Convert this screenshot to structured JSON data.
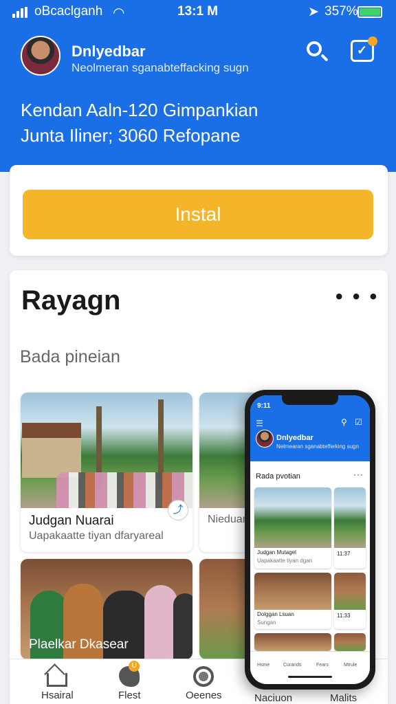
{
  "status_bar": {
    "carrier": "oBcaclganh",
    "time": "13:1 M",
    "battery_pct": "357%",
    "battery_color": "#3fd36a"
  },
  "header": {
    "background": "#1a6fe6",
    "user_name": "Dnlyedbar",
    "user_subtitle": "Neolmeran sganabteffacking sugn",
    "headline_line1": "Kendan Aaln-120 Gimpankian",
    "headline_line2": "Junta Iliner; 3060 Refopane"
  },
  "install": {
    "button_label": "Instal",
    "button_color": "#f5b52b"
  },
  "feed": {
    "title": "Rayagn",
    "more_label": "• • •",
    "subtitle": "Bada pineian",
    "posts": [
      {
        "title": "Judgan Nuarai",
        "desc": "Uapakaatte tiyan dfaryareal"
      },
      {
        "title": "Nieduan",
        "desc": ""
      },
      {
        "title": "Plaelkar Dkasear",
        "desc": ""
      }
    ]
  },
  "tabbar": {
    "tabs": [
      {
        "label": "Hsairal",
        "icon": "home-icon"
      },
      {
        "label": "Flest",
        "icon": "festival-icon"
      },
      {
        "label": "Oeenes",
        "icon": "circle-icon"
      },
      {
        "label": "Naciuon",
        "icon": "search-icon"
      },
      {
        "label": "Malits",
        "icon": "grid-icon"
      }
    ]
  },
  "phone_mockup": {
    "time": "9:11",
    "user_name": "Dnlyedbar",
    "user_subtitle": "Nelmearan sganabtefferking sugn",
    "section_title": "Rada pvotian",
    "tiles": [
      {
        "title": "Judgan Mutagel",
        "desc": "Uapakaatte tiyan dgan"
      },
      {
        "title": "11:37",
        "desc": ""
      },
      {
        "title": "Dolggan Lsuan",
        "desc": "Sungan"
      },
      {
        "title": "11:33",
        "desc": ""
      }
    ],
    "tabs": [
      "Hsme",
      "Curands",
      "Fears",
      "Mtrule"
    ]
  }
}
